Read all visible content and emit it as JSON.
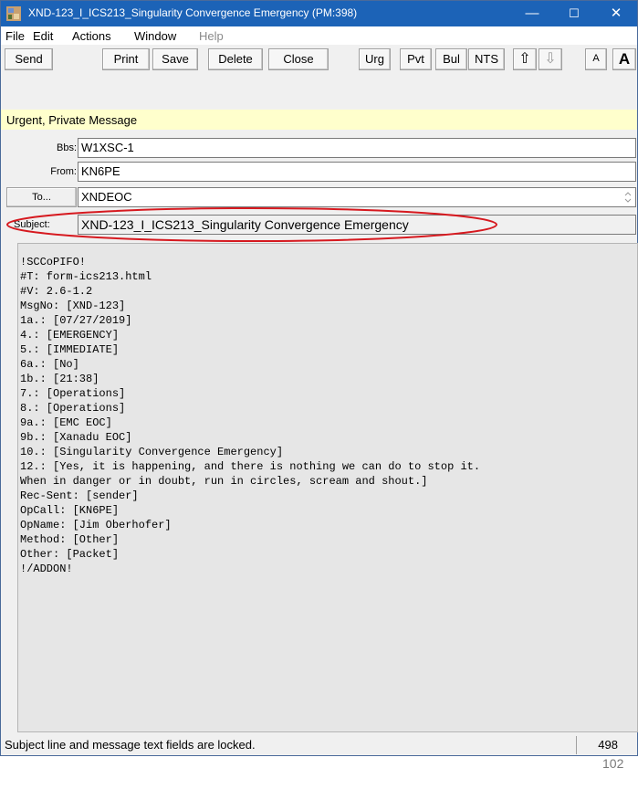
{
  "window": {
    "title": "XND-123_I_ICS213_Singularity Convergence Emergency  (PM:398)",
    "controls": {
      "minimize": "—",
      "maximize": "☐",
      "close": "✕"
    }
  },
  "menu": [
    "File",
    "Edit",
    "Actions",
    "Window",
    "Help"
  ],
  "toolbar": {
    "send": "Send",
    "print": "Print",
    "save": "Save",
    "delete": "Delete",
    "close": "Close",
    "urg": "Urg",
    "pvt": "Pvt",
    "bul": "Bul",
    "nts": "NTS",
    "up": "⇧",
    "down": "⇩",
    "font_small": "A",
    "font_large": "A"
  },
  "priority_banner": "Urgent, Private Message",
  "fields": {
    "bbs_label": "Bbs:",
    "bbs_value": "W1XSC-1",
    "from_label": "From:",
    "from_value": "KN6PE",
    "to_button": "To...",
    "to_value": "XNDEOC",
    "subject_label": "Subject:",
    "subject_value": "XND-123_I_ICS213_Singularity Convergence Emergency"
  },
  "message_lines": [
    "!SCCoPIFO!",
    "#T: form-ics213.html",
    "#V: 2.6-1.2",
    "MsgNo: [XND-123]",
    "1a.: [07/27/2019]",
    "4.: [EMERGENCY]",
    "5.: [IMMEDIATE]",
    "6a.: [No]",
    "1b.: [21:38]",
    "7.: [Operations]",
    "8.: [Operations]",
    "9a.: [EMC EOC]",
    "9b.: [Xanadu EOC]",
    "10.: [Singularity Convergence Emergency]",
    "12.: [Yes, it is happening, and there is nothing we can do to stop it.",
    "When in danger or in doubt, run in circles, scream and shout.]",
    "Rec-Sent: [sender]",
    "OpCall: [KN6PE]",
    "OpName: [Jim Oberhofer]",
    "Method: [Other]",
    "Other: [Packet]",
    "!/ADDON!"
  ],
  "status": {
    "text": "Subject line and message text fields are locked.",
    "count": "498"
  },
  "page_number": "102",
  "colors": {
    "titlebar": "#1c63b7",
    "priority_banner": "#ffffcc",
    "annotation": "#d6191f"
  },
  "icons": [
    "app-icon",
    "up-arrow-icon",
    "down-arrow-icon",
    "scroll-icon"
  ]
}
